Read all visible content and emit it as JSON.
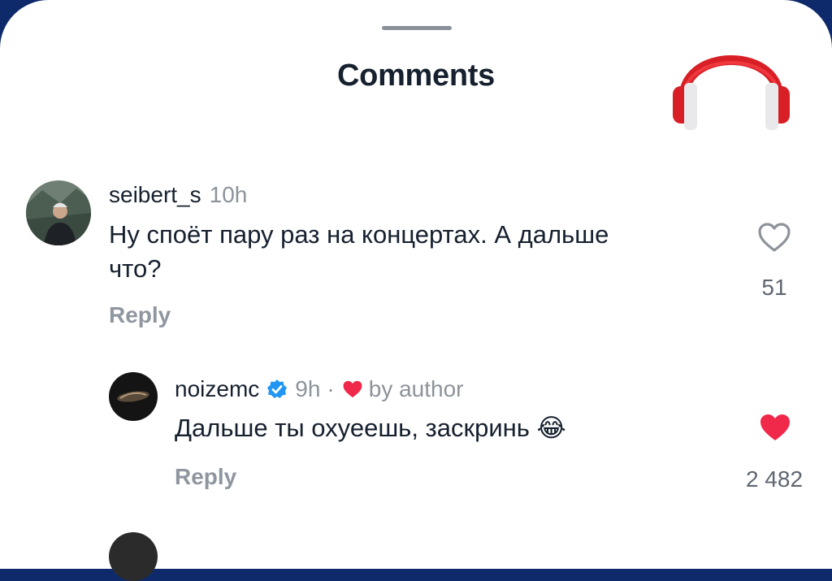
{
  "header": {
    "title": "Comments"
  },
  "comments": [
    {
      "username": "seibert_s",
      "time": "10h",
      "text": "Ну споёт пару раз на концертах. А дальше что?",
      "text_line1": "Ну споёт пару раз на концертах. А дальше",
      "text_line2": "что?",
      "reply_label": "Reply",
      "likes": "51",
      "liked": false
    },
    {
      "username": "noizemc",
      "verified": true,
      "time": "9h",
      "separator": "·",
      "author_like_label": "by author",
      "text": "Дальше ты охуеешь, заскринь 😂",
      "emoji": "😂",
      "reply_label": "Reply",
      "likes": "2 482",
      "liked": true
    }
  ],
  "colors": {
    "like_red": "#f0284a",
    "verified_blue": "#2196f3",
    "text_primary": "#16202e",
    "text_secondary": "#8d939b"
  },
  "icons": [
    "headphones-icon",
    "heart-outline-icon",
    "heart-filled-icon",
    "verified-badge-icon"
  ]
}
